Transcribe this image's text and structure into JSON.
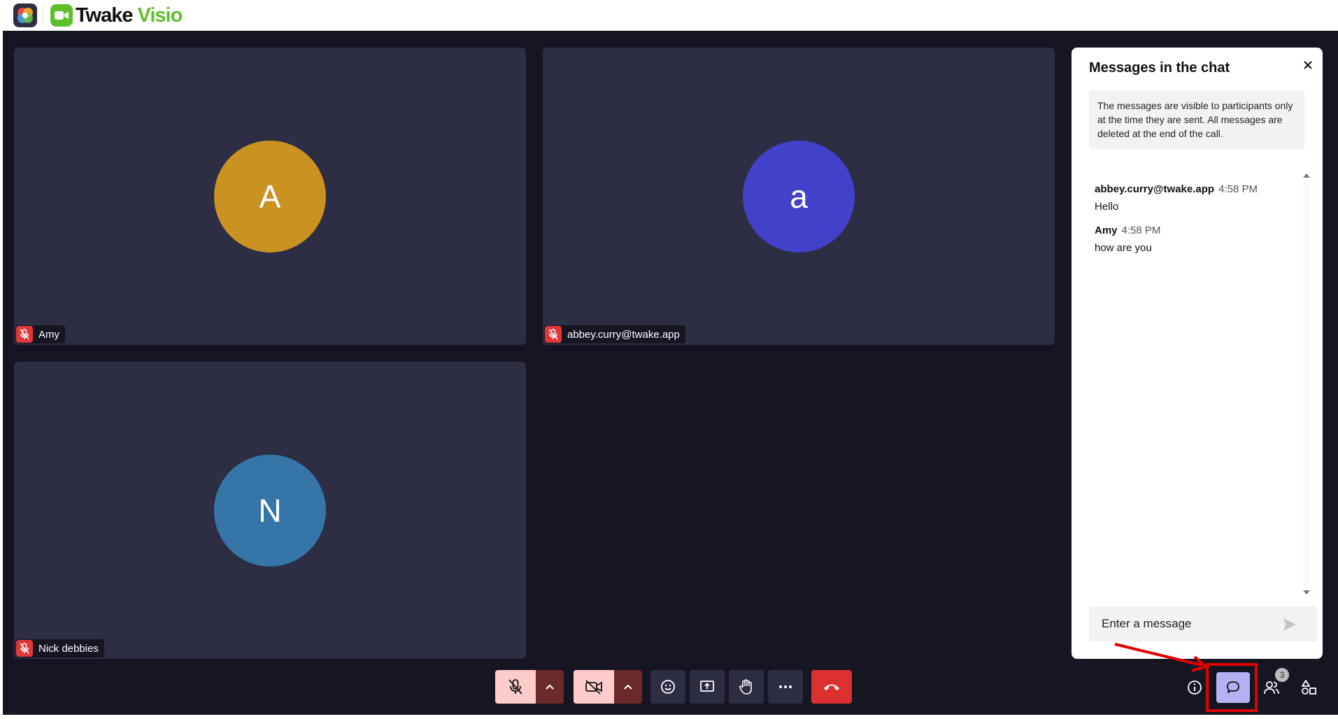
{
  "brand": {
    "name_part1": "Twake",
    "name_part2": "Visio"
  },
  "participants": [
    {
      "name": "Amy",
      "initial": "A",
      "color": "#c99221"
    },
    {
      "name": "abbey.curry@twake.app",
      "initial": "a",
      "color": "#4241c9"
    },
    {
      "name": "Nick debbies",
      "initial": "N",
      "color": "#3575a8"
    }
  ],
  "chat": {
    "title": "Messages in the chat",
    "notice": "The messages are visible to participants only at the time they are sent. All messages are deleted at the end of the call.",
    "messages": [
      {
        "author": "abbey.curry@twake.app",
        "time": "4:58 PM",
        "text": "Hello"
      },
      {
        "author": "Amy",
        "time": "4:58 PM",
        "text": "how are you"
      }
    ],
    "input_placeholder": "Enter a message"
  },
  "participants_count": "3",
  "colors": {
    "stage": "#161622",
    "tile": "#2d2d44",
    "accent": "#5fbf2a",
    "hangup": "#dc3030",
    "chat_active": "#b4b0f2",
    "annotation": "#e00000"
  },
  "icons": [
    "app-launcher-icon",
    "video-icon",
    "mic-off-icon",
    "chevron-up-icon",
    "camera-off-icon",
    "emoji-icon",
    "screen-share-icon",
    "raise-hand-icon",
    "more-icon",
    "hangup-icon",
    "info-icon",
    "chat-icon",
    "participants-icon",
    "shapes-icon",
    "close-icon",
    "send-icon"
  ]
}
